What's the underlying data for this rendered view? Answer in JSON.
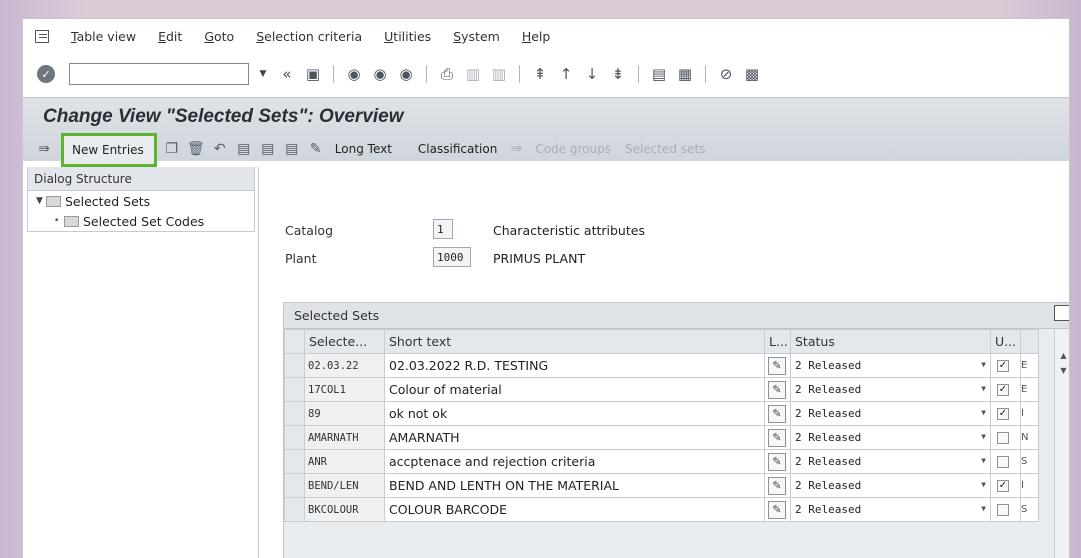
{
  "menu": {
    "items": [
      "Table view",
      "Edit",
      "Goto",
      "Selection criteria",
      "Utilities",
      "System",
      "Help"
    ]
  },
  "system_toolbar": {
    "command_field_value": "",
    "icons": [
      "enter-icon",
      "back-icon",
      "save-icon",
      "back-nav-icon",
      "exit-icon",
      "cancel-icon",
      "print-icon",
      "find-icon",
      "find-next-icon",
      "first-page-icon",
      "prev-page-icon",
      "next-page-icon",
      "last-page-icon",
      "new-session-icon",
      "shortcut-icon",
      "help-icon",
      "customize-icon"
    ]
  },
  "title": "Change View \"Selected Sets\": Overview",
  "app_toolbar": {
    "new_entries": "New Entries",
    "long_text": "Long Text",
    "classification": "Classification",
    "code_groups": "Code groups",
    "selected_sets": "Selected sets"
  },
  "dialog_structure": {
    "header": "Dialog Structure",
    "items": [
      {
        "label": "Selected Sets"
      },
      {
        "label": "Selected Set Codes"
      }
    ]
  },
  "fields": {
    "catalog": {
      "label": "Catalog",
      "value": "1",
      "desc": "Characteristic attributes"
    },
    "plant": {
      "label": "Plant",
      "value": "1000",
      "desc": "PRIMUS PLANT"
    }
  },
  "table": {
    "title": "Selected Sets",
    "headers": {
      "key": "Selecte...",
      "text": "Short text",
      "lang": "L...",
      "status": "Status",
      "usage": "U..."
    },
    "rows": [
      {
        "key": "02.03.22",
        "text": "02.03.2022 R.D. TESTING",
        "status": "2 Released",
        "checked": true,
        "extra": "E"
      },
      {
        "key": "17COL1",
        "text": "Colour of material",
        "status": "2 Released",
        "checked": true,
        "extra": "E"
      },
      {
        "key": "89",
        "text": "ok not ok",
        "status": "2 Released",
        "checked": true,
        "extra": "I"
      },
      {
        "key": "AMARNATH",
        "text": "AMARNATH",
        "status": "2 Released",
        "checked": false,
        "extra": "N"
      },
      {
        "key": "ANR",
        "text": "accptenace and rejection criteria",
        "status": "2 Released",
        "checked": false,
        "extra": "S"
      },
      {
        "key": "BEND/LEN",
        "text": "BEND AND LENTH ON THE MATERIAL",
        "status": "2 Released",
        "checked": true,
        "extra": "I"
      },
      {
        "key": "BKCOLOUR",
        "text": "COLOUR BARCODE",
        "status": "2 Released",
        "checked": false,
        "extra": "S"
      }
    ]
  },
  "colors": {
    "highlight_border": "#5cb531",
    "title_bg": "#d6dbe1"
  }
}
